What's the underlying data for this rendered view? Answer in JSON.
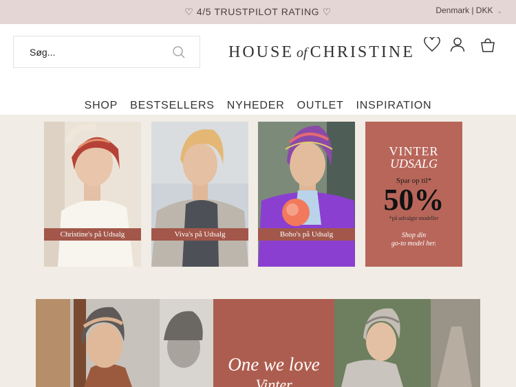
{
  "topbar": {
    "trust_text": "♡ 4/5 TRUSTPILOT RATING ♡",
    "locale": "Denmark | DKK",
    "chevron": "⌄"
  },
  "header": {
    "search_placeholder": "Søg...",
    "logo": {
      "left": "HOUSE",
      "of": "of",
      "right": "CHRISTINE"
    },
    "icons": [
      "heart-icon",
      "user-icon",
      "bag-icon"
    ]
  },
  "nav": {
    "items": [
      "SHOP",
      "BESTSELLERS",
      "NYHEDER",
      "OUTLET",
      "INSPIRATION"
    ]
  },
  "tiles": [
    {
      "caption": "Christine's på Udsalg"
    },
    {
      "caption": "Viva's på Udsalg"
    },
    {
      "caption": "Boho's på Udsalg"
    }
  ],
  "promo": {
    "line1": "VINTER",
    "line2": "UDSALG",
    "line3": "Spar op til*",
    "line4": "50%",
    "line5": "*på udvalgte modeller",
    "line6": "Shop din",
    "line7": "go-to model her."
  },
  "banner": {
    "title": "One we love",
    "subtitle": "Vinter"
  },
  "colors": {
    "topbar": "#e4d6d4",
    "accent": "#b8665a",
    "background": "#f1ece6"
  }
}
